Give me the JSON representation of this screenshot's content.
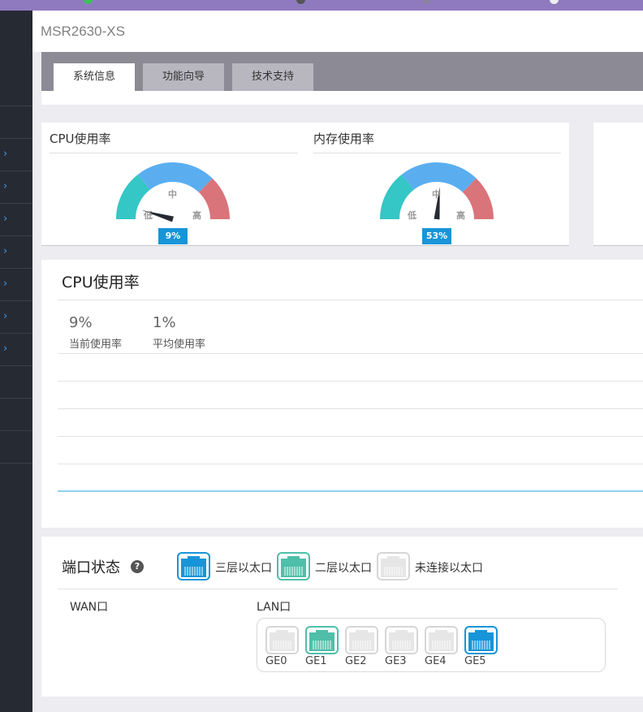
{
  "device": {
    "title": "MSR2630-XS"
  },
  "tabs": [
    {
      "label": "系统信息",
      "active": true
    },
    {
      "label": "功能向导",
      "active": false
    },
    {
      "label": "技术支持",
      "active": false
    }
  ],
  "gauges": {
    "cpu": {
      "title": "CPU使用率",
      "value_text": "9%",
      "value": 9,
      "low": "低",
      "mid": "中",
      "high": "高"
    },
    "memory": {
      "title": "内存使用率",
      "value_text": "53%",
      "value": 53,
      "low": "低",
      "mid": "中",
      "high": "高"
    }
  },
  "cpu_panel": {
    "title": "CPU使用率",
    "current_value": "9%",
    "current_label": "当前使用率",
    "average_value": "1%",
    "average_label": "平均使用率"
  },
  "ports": {
    "title": "端口状态",
    "help_icon": "question-circle-icon",
    "legend": [
      {
        "label": "三层以太口",
        "type": "l3"
      },
      {
        "label": "二层以太口",
        "type": "l2"
      },
      {
        "label": "未连接以太口",
        "type": "down"
      }
    ],
    "wan_label": "WAN口",
    "lan_label": "LAN口",
    "lan_ports": [
      {
        "name": "GE0",
        "type": "down"
      },
      {
        "name": "GE1",
        "type": "l2"
      },
      {
        "name": "GE2",
        "type": "down"
      },
      {
        "name": "GE3",
        "type": "down"
      },
      {
        "name": "GE4",
        "type": "down"
      },
      {
        "name": "GE5",
        "type": "l3"
      }
    ]
  },
  "colors": {
    "l3": "#1795d8",
    "l2": "#4fbfa9",
    "down": "#d6d6d6",
    "gauge_low": "#35c6c6",
    "gauge_mid": "#5aaef0",
    "gauge_high": "#d9747a",
    "sidebar": "#262a33",
    "accent": "#8f7ac0"
  }
}
